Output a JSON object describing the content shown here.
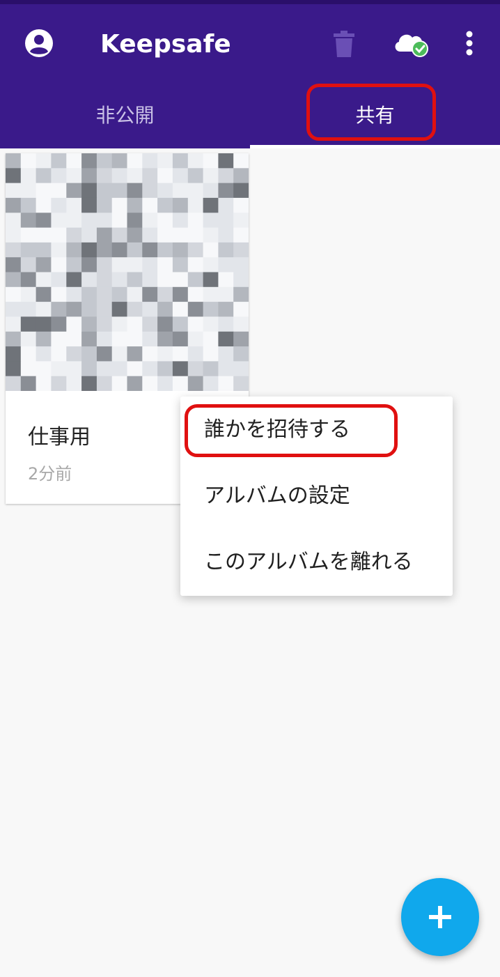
{
  "app_bar": {
    "title": "Keepsafe",
    "icons": [
      "account-icon",
      "trash-icon",
      "cloud-sync-icon",
      "more-vert-icon"
    ]
  },
  "tabs": [
    {
      "label": "非公開",
      "selected": false
    },
    {
      "label": "共有",
      "selected": true
    }
  ],
  "album": {
    "name": "仕事用",
    "time": "2分前"
  },
  "menu": {
    "items": [
      {
        "label": "誰かを招待する"
      },
      {
        "label": "アルバムの設定"
      },
      {
        "label": "このアルバムを離れる"
      }
    ]
  },
  "fab": {
    "icon": "plus-icon"
  },
  "colors": {
    "app_bar": "#3a1a8a",
    "fab": "#10a8ec",
    "highlight": "#e01010"
  }
}
